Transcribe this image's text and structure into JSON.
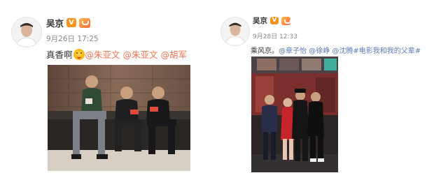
{
  "posts": [
    {
      "author": "吴京",
      "verified_mark": "V",
      "time": "9月26日 17:25",
      "text_lead": "真香啊",
      "mentions": [
        "@朱亚文",
        "@朱亚文",
        "@胡军"
      ]
    },
    {
      "author": "吴京",
      "verified_mark": "V",
      "time": "9月28日 12:33",
      "text_lead": "乘风京。",
      "mentions": [
        "@章子怡",
        "@徐峥",
        "@沈腾"
      ],
      "hashtag": "#电影我和我的父辈#"
    }
  ],
  "colors": {
    "link": "#eb7350",
    "verified": "#f7931e"
  }
}
